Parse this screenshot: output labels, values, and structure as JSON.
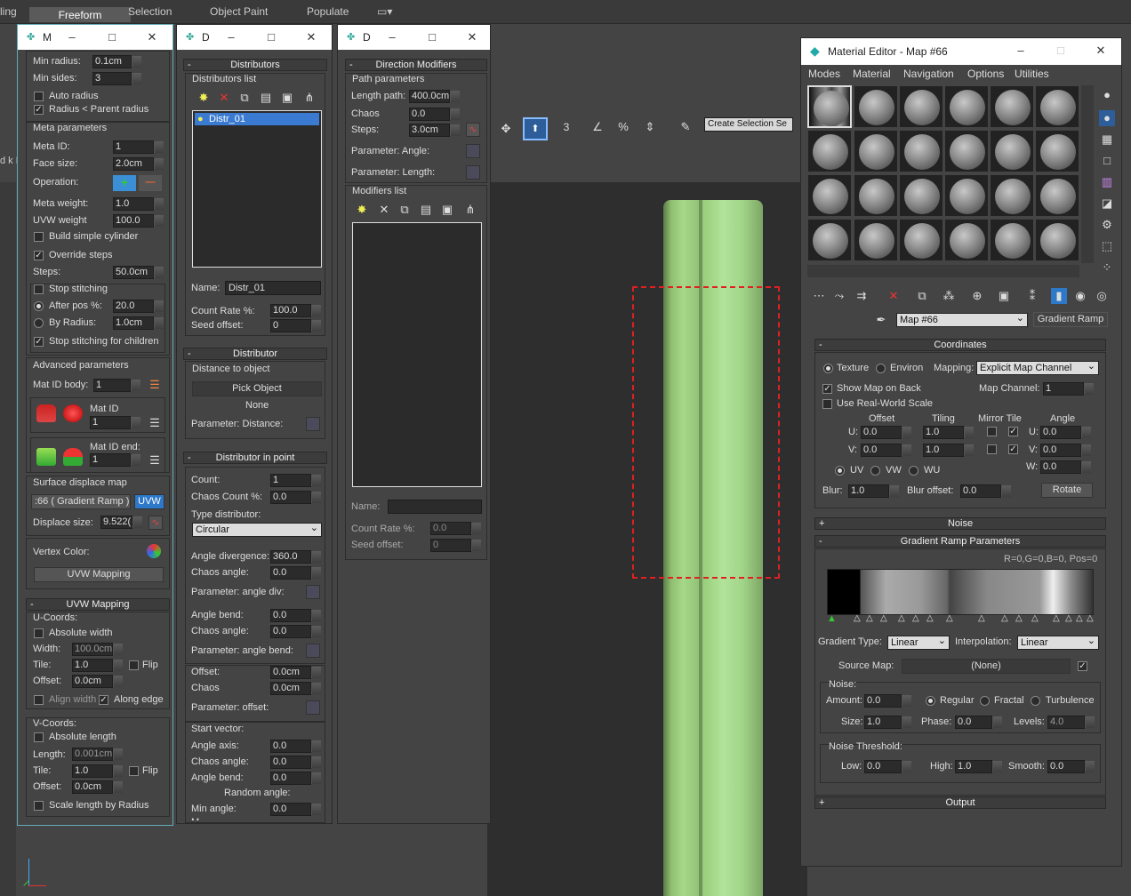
{
  "ribbon": {
    "left_cut": "ling",
    "tabs": [
      "Freeform",
      "Selection",
      "Object Paint",
      "Populate"
    ],
    "left_label": "d k E"
  },
  "toolbar": {
    "selection_set_placeholder": "Create Selection Se",
    "snap_label": "3",
    "pct_label": "%"
  },
  "panel1": {
    "title": "M",
    "min_radius_label": "Min radius:",
    "min_radius": "0.1cm",
    "min_sides_label": "Min sides:",
    "min_sides": "3",
    "auto_radius": "Auto radius",
    "radius_parent": "Radius < Parent radius",
    "meta_params": "Meta parameters",
    "meta_id_label": "Meta ID:",
    "meta_id": "1",
    "face_size_label": "Face size:",
    "face_size": "2.0cm",
    "operation_label": "Operation:",
    "meta_weight_label": "Meta weight:",
    "meta_weight": "1.0",
    "uvw_weight_label": "UVW weight",
    "uvw_weight": "100.0",
    "build_cyl": "Build simple cylinder",
    "override_steps": "Override steps",
    "steps_label": "Steps:",
    "steps": "50.0cm",
    "stop_stitching": "Stop stitching",
    "after_pos_label": "After pos %:",
    "after_pos": "20.0",
    "by_radius_label": "By Radius:",
    "by_radius": "1.0cm",
    "stop_children": "Stop stitching for children",
    "adv_params": "Advanced parameters",
    "mat_id_body_label": "Mat ID body:",
    "mat_id_body": "1",
    "mat_id_label": "Mat ID",
    "mat_id": "1",
    "mat_id_end_label": "Mat ID end:",
    "mat_id_end": "1",
    "surface_disp": "Surface displace map",
    "disp_map": ":66 ( Gradient Ramp )",
    "uvw_btn": "UVW",
    "disp_size_label": "Displace size:",
    "disp_size": "9.522(",
    "vertex_color": "Vertex Color:",
    "uvw_mapping_btn": "UVW Mapping",
    "uvw_mapping_head": "UVW Mapping",
    "ucoords": "U-Coords:",
    "abs_width": "Absolute width",
    "width_label": "Width:",
    "width": "100.0cm",
    "tile_label": "Tile:",
    "tile_u": "1.0",
    "flip": "Flip",
    "offset_label": "Offset:",
    "offset_u": "0.0cm",
    "align_width": "Align width",
    "along_edge": "Along edge",
    "vcoords": "V-Coords:",
    "abs_length": "Absolute length",
    "length_label": "Length:",
    "length": "0.001cm",
    "tile_v": "1.0",
    "offset_v": "0.0cm",
    "scale_length": "Scale length by Radius"
  },
  "panel2": {
    "title": "D",
    "distributors": "Distributors",
    "dist_list": "Distributors list",
    "item": "Distr_01",
    "name_label": "Name:",
    "name": "Distr_01",
    "count_rate_label": "Count Rate %:",
    "count_rate": "100.0",
    "seed_label": "Seed offset:",
    "seed": "0",
    "distributor": "Distributor",
    "dist_to_obj": "Distance to object",
    "pick_object": "Pick Object",
    "none": "None",
    "param_distance": "Parameter: Distance:",
    "dist_in_point": "Distributor in point",
    "count_label": "Count:",
    "count": "1",
    "chaos_count_label": "Chaos Count %:",
    "chaos_count": "0.0",
    "type_dist_label": "Type distributor:",
    "type_dist": "Circular",
    "angle_div_label": "Angle divergence:",
    "angle_div": "360.0",
    "chaos_angle_label": "Chaos angle:",
    "chaos_angle": "0.0",
    "param_angle_div": "Parameter: angle div:",
    "angle_bend_label": "Angle bend:",
    "angle_bend": "0.0",
    "chaos_angle2": "0.0",
    "param_angle_bend": "Parameter: angle bend:",
    "offset_label": "Offset:",
    "offset": "0.0cm",
    "chaos_label": "Chaos",
    "chaos": "0.0cm",
    "param_offset": "Parameter: offset:",
    "start_vector": "Start vector:",
    "angle_axis_label": "Angle axis:",
    "angle_axis": "0.0",
    "chaos_angle3": "0.0",
    "angle_bend2": "0.0",
    "random_angle": "Random angle:",
    "min_angle_label": "Min angle:",
    "min_angle": "0.0",
    "cut_label": "M"
  },
  "panel3": {
    "title": "D",
    "dir_mod": "Direction Modifiers",
    "path_params": "Path parameters",
    "length_path_label": "Length path:",
    "length_path": "400.0cm",
    "chaos_label": "Chaos",
    "chaos": "0.0",
    "steps_label": "Steps:",
    "steps": "3.0cm",
    "param_angle": "Parameter: Angle:",
    "param_length": "Parameter: Length:",
    "mod_list": "Modifiers list",
    "name_label": "Name:",
    "count_rate_label": "Count Rate %:",
    "count_rate": "0.0",
    "seed_label": "Seed offset:",
    "seed": "0"
  },
  "mateditor": {
    "title": "Material Editor - Map #66",
    "menu": [
      "Modes",
      "Material",
      "Navigation",
      "Options",
      "Utilities"
    ],
    "map_name": "Map #66",
    "map_type": "Gradient Ramp",
    "coords": "Coordinates",
    "texture": "Texture",
    "environ": "Environ",
    "mapping_label": "Mapping:",
    "mapping": "Explicit Map Channel",
    "show_map_back": "Show Map on Back",
    "map_channel_label": "Map Channel:",
    "map_channel": "1",
    "real_world": "Use Real-World Scale",
    "offset_h": "Offset",
    "tiling_h": "Tiling",
    "mirror_tile_h": "Mirror Tile",
    "angle_h": "Angle",
    "u_label": "U:",
    "v_label": "V:",
    "w_label": "W:",
    "u_offset": "0.0",
    "u_tiling": "1.0",
    "u_angle": "0.0",
    "v_offset": "0.0",
    "v_tiling": "1.0",
    "v_angle": "0.0",
    "w_angle": "0.0",
    "uv": "UV",
    "vw": "VW",
    "wu": "WU",
    "blur_label": "Blur:",
    "blur": "1.0",
    "blur_off_label": "Blur offset:",
    "blur_off": "0.0",
    "rotate": "Rotate",
    "noise_head": "Noise",
    "grad_params": "Gradient Ramp Parameters",
    "ramp_info": "R=0,G=0,B=0, Pos=0",
    "grad_type_label": "Gradient Type:",
    "grad_type": "Linear",
    "interp_label": "Interpolation:",
    "interp": "Linear",
    "source_map_label": "Source Map:",
    "source_map": "(None)",
    "noise_label": "Noise:",
    "amount_label": "Amount:",
    "amount": "0.0",
    "regular": "Regular",
    "fractal": "Fractal",
    "turbulence": "Turbulence",
    "size_label": "Size:",
    "size": "1.0",
    "phase_label": "Phase:",
    "phase": "0.0",
    "levels_label": "Levels:",
    "levels": "4.0",
    "noise_thresh": "Noise Threshold:",
    "low_label": "Low:",
    "low": "0.0",
    "high_label": "High:",
    "high": "1.0",
    "smooth_label": "Smooth:",
    "smooth": "0.0",
    "output": "Output"
  }
}
